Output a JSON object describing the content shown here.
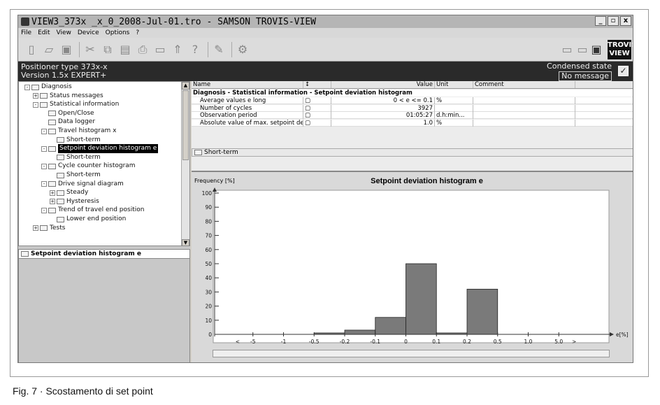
{
  "window": {
    "title": "VIEW3_373x _x_0_2008-Jul-01.tro - SAMSON TROVIS-VIEW",
    "controls": [
      "_",
      "▫",
      "x"
    ]
  },
  "menu": [
    "File",
    "Edit",
    "View",
    "Device",
    "Options",
    "?"
  ],
  "logo": {
    "line1": "TROVIS",
    "line2": "VIEW"
  },
  "info": {
    "line1": "Positioner type 373x-x",
    "line2": "Version 1.5x EXPERT+",
    "condensed_label": "Condensed state",
    "condensed_value": "No message"
  },
  "tree": [
    {
      "label": "Diagnosis",
      "level": 0,
      "pm": "-"
    },
    {
      "label": "Status messages",
      "level": 1,
      "pm": "+"
    },
    {
      "label": "Statistical information",
      "level": 1,
      "pm": "-"
    },
    {
      "label": "Open/Close",
      "level": 2,
      "pm": ""
    },
    {
      "label": "Data logger",
      "level": 2,
      "pm": ""
    },
    {
      "label": "Travel histogram x",
      "level": 2,
      "pm": "-"
    },
    {
      "label": "Short-term",
      "level": 3,
      "pm": ""
    },
    {
      "label": "Setpoint deviation histogram e",
      "level": 2,
      "pm": "-",
      "selected": true
    },
    {
      "label": "Short-term",
      "level": 3,
      "pm": ""
    },
    {
      "label": "Cycle counter histogram",
      "level": 2,
      "pm": "-"
    },
    {
      "label": "Short-term",
      "level": 3,
      "pm": ""
    },
    {
      "label": "Drive signal diagram",
      "level": 2,
      "pm": "-"
    },
    {
      "label": "Steady",
      "level": 3,
      "pm": "+"
    },
    {
      "label": "Hysteresis",
      "level": 3,
      "pm": "+"
    },
    {
      "label": "Trend of travel end position",
      "level": 2,
      "pm": "-"
    },
    {
      "label": "Lower end position",
      "level": 3,
      "pm": ""
    },
    {
      "label": "Tests",
      "level": 1,
      "pm": "+"
    }
  ],
  "lower_panel_title": "Setpoint deviation histogram e",
  "table": {
    "headers": [
      "Name",
      "↕",
      "Value",
      "Unit",
      "Comment"
    ],
    "group": "Diagnosis - Statistical information - Setpoint deviation histogram",
    "rows": [
      {
        "name": "Average values e long",
        "value": "0 < e  <= 0.1",
        "unit": "%"
      },
      {
        "name": "Number of cycles",
        "value": "3927",
        "unit": ""
      },
      {
        "name": "Observation period",
        "value": "01:05:27",
        "unit": "d.h:min..."
      },
      {
        "name": "Absolute value of max. setpoint devia...",
        "value": "1.0",
        "unit": "%"
      }
    ],
    "short_term": "Short-term"
  },
  "chart_data": {
    "type": "bar",
    "title": "Setpoint deviation histogram e",
    "ylabel": "Frequency [%]",
    "xlabel": "e[%]",
    "ylim": [
      0,
      100
    ],
    "yticks": [
      0,
      10,
      20,
      30,
      40,
      50,
      60,
      70,
      80,
      90,
      100
    ],
    "categories": [
      "< -5",
      "-5..-1",
      "-1..-0.5",
      "-0.5..-0.2",
      "-0.2..-0.1",
      "-0.1..0",
      "0..0.1",
      "0.1..0.2",
      "0.2..0.5",
      "0.5..1.0",
      "1.0..5.0",
      "> 5"
    ],
    "values": [
      0,
      0,
      0,
      1,
      3,
      12,
      50,
      1,
      32,
      0,
      0,
      0
    ],
    "boundary_labels": [
      "<",
      "-5",
      "-1",
      "-0.5",
      "-0.2",
      "-0.1",
      "0",
      "0.1",
      "0.2",
      "0.5",
      "1.0",
      "5.0",
      ">"
    ],
    "bar_color": "#7a7a7a",
    "grid": false
  },
  "caption": "Fig. 7 · Scostamento di set point"
}
